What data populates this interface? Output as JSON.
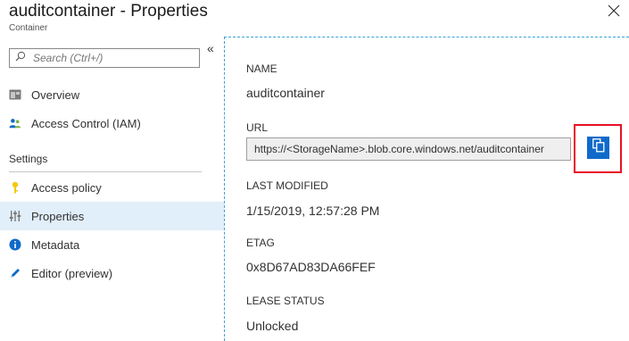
{
  "header": {
    "title": "auditcontainer - Properties",
    "subtitle": "Container"
  },
  "sidebar": {
    "search_placeholder": "Search (Ctrl+/)",
    "collapse_glyph": "«",
    "items": [
      {
        "label": "Overview",
        "icon": "overview-icon"
      },
      {
        "label": "Access Control (IAM)",
        "icon": "iam-people-icon"
      }
    ],
    "settings_header": "Settings",
    "settings_items": [
      {
        "label": "Access policy",
        "icon": "key-icon"
      },
      {
        "label": "Properties",
        "icon": "properties-sliders-icon",
        "active": true
      },
      {
        "label": "Metadata",
        "icon": "info-icon"
      },
      {
        "label": "Editor (preview)",
        "icon": "pencil-icon"
      }
    ]
  },
  "properties": {
    "name_label": "NAME",
    "name_value": "auditcontainer",
    "url_label": "URL",
    "url_value": "https://<StorageName>.blob.core.windows.net/auditcontainer",
    "last_modified_label": "LAST MODIFIED",
    "last_modified_value": "1/15/2019, 12:57:28 PM",
    "etag_label": "ETAG",
    "etag_value": "0x8D67AD83DA66FEF",
    "lease_status_label": "LEASE STATUS",
    "lease_status_value": "Unlocked"
  },
  "colors": {
    "accent": "#0f6ac9",
    "active_bg": "#e1effa",
    "highlight": "#e81123",
    "divider": "#3aa3d9"
  }
}
